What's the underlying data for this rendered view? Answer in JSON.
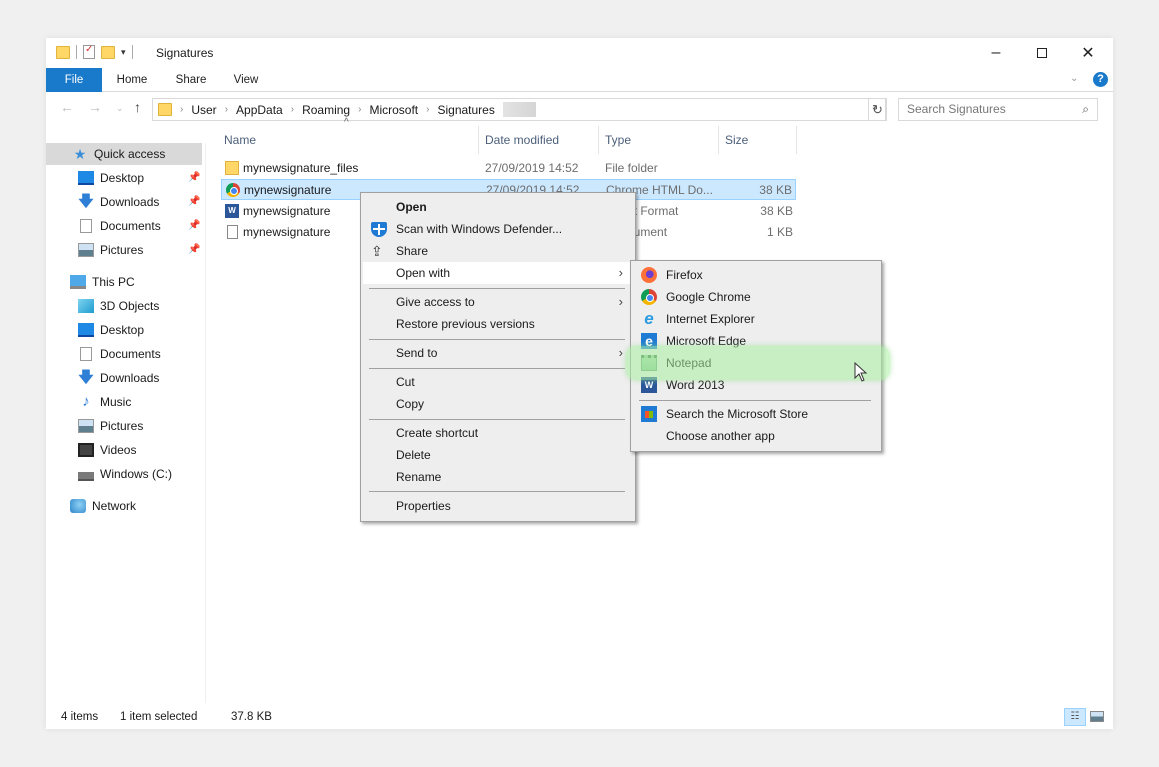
{
  "window": {
    "title": "Signatures",
    "controls": {
      "minimize": "–",
      "maximize": "",
      "close": "✕"
    }
  },
  "ribbon": {
    "tabs": [
      {
        "label": "File",
        "active": true
      },
      {
        "label": "Home"
      },
      {
        "label": "Share"
      },
      {
        "label": "View"
      }
    ],
    "help": "?"
  },
  "navigation": {
    "back": "←",
    "forward": "→",
    "recent": "⌄",
    "up": "↑",
    "breadcrumbs": [
      "User",
      "AppData",
      "Roaming",
      "Microsoft",
      "Signatures"
    ],
    "search_placeholder": "Search Signatures"
  },
  "sidebar": {
    "items": [
      {
        "label": "Quick access",
        "icon": "star-icon",
        "selected": true
      },
      {
        "label": "Desktop",
        "icon": "desktop-icon",
        "pinned": true
      },
      {
        "label": "Downloads",
        "icon": "download-icon",
        "pinned": true
      },
      {
        "label": "Documents",
        "icon": "documents-icon",
        "pinned": true
      },
      {
        "label": "Pictures",
        "icon": "pictures-icon",
        "pinned": true
      },
      {
        "label": "This PC",
        "icon": "computer-icon"
      },
      {
        "label": "3D Objects",
        "icon": "3d-objects-icon"
      },
      {
        "label": "Desktop",
        "icon": "desktop-icon"
      },
      {
        "label": "Documents",
        "icon": "documents-icon"
      },
      {
        "label": "Downloads",
        "icon": "download-icon"
      },
      {
        "label": "Music",
        "icon": "music-icon"
      },
      {
        "label": "Pictures",
        "icon": "pictures-icon"
      },
      {
        "label": "Videos",
        "icon": "videos-icon"
      },
      {
        "label": "Windows (C:)",
        "icon": "drive-icon"
      },
      {
        "label": "Network",
        "icon": "network-icon"
      }
    ]
  },
  "filelist": {
    "columns": [
      "Name",
      "Date modified",
      "Type",
      "Size"
    ],
    "rows": [
      {
        "name": "mynewsignature_files",
        "date": "27/09/2019 14:52",
        "type": "File folder",
        "size": "",
        "icon": "folder-icon"
      },
      {
        "name": "mynewsignature",
        "date": "27/09/2019 14:52",
        "type": "Chrome HTML Do...",
        "size": "38 KB",
        "icon": "chrome-icon",
        "selected": true
      },
      {
        "name": "mynewsignature",
        "date": "",
        "type": "ext Format",
        "size": "38 KB",
        "icon": "word-doc-icon"
      },
      {
        "name": "mynewsignature",
        "date": "",
        "type": "ocument",
        "size": "1 KB",
        "icon": "text-file-icon"
      }
    ]
  },
  "status": {
    "count": "4 items",
    "selected": "1 item selected",
    "size": "37.8 KB"
  },
  "context_menu": {
    "items": [
      {
        "label": "Open",
        "bold": true
      },
      {
        "label": "Scan with Windows Defender...",
        "icon": "defender-icon"
      },
      {
        "label": "Share",
        "icon": "share-icon"
      },
      {
        "label": "Open with",
        "submenu": true,
        "hover": true
      },
      {
        "label": "Give access to",
        "submenu": true
      },
      {
        "label": "Restore previous versions"
      },
      {
        "label": "Send to",
        "submenu": true
      },
      {
        "label": "Cut"
      },
      {
        "label": "Copy"
      },
      {
        "label": "Create shortcut"
      },
      {
        "label": "Delete"
      },
      {
        "label": "Rename"
      },
      {
        "label": "Properties"
      }
    ],
    "submenu_arrow": "›"
  },
  "open_with_menu": {
    "items": [
      {
        "label": "Firefox",
        "icon": "firefox-icon"
      },
      {
        "label": "Google Chrome",
        "icon": "chrome-icon"
      },
      {
        "label": "Internet Explorer",
        "icon": "internet-explorer-icon"
      },
      {
        "label": "Microsoft Edge",
        "icon": "edge-icon"
      },
      {
        "label": "Notepad",
        "icon": "notepad-icon",
        "highlighted": true
      },
      {
        "label": "Word 2013",
        "icon": "word-icon"
      },
      {
        "label": "Search the Microsoft Store",
        "icon": "store-icon"
      },
      {
        "label": "Choose another app"
      }
    ],
    "highlight_color": "#aaf0a0"
  },
  "colors": {
    "accent": "#1979ca",
    "selection": "#cce8ff",
    "menu_bg": "#eeeeee"
  }
}
